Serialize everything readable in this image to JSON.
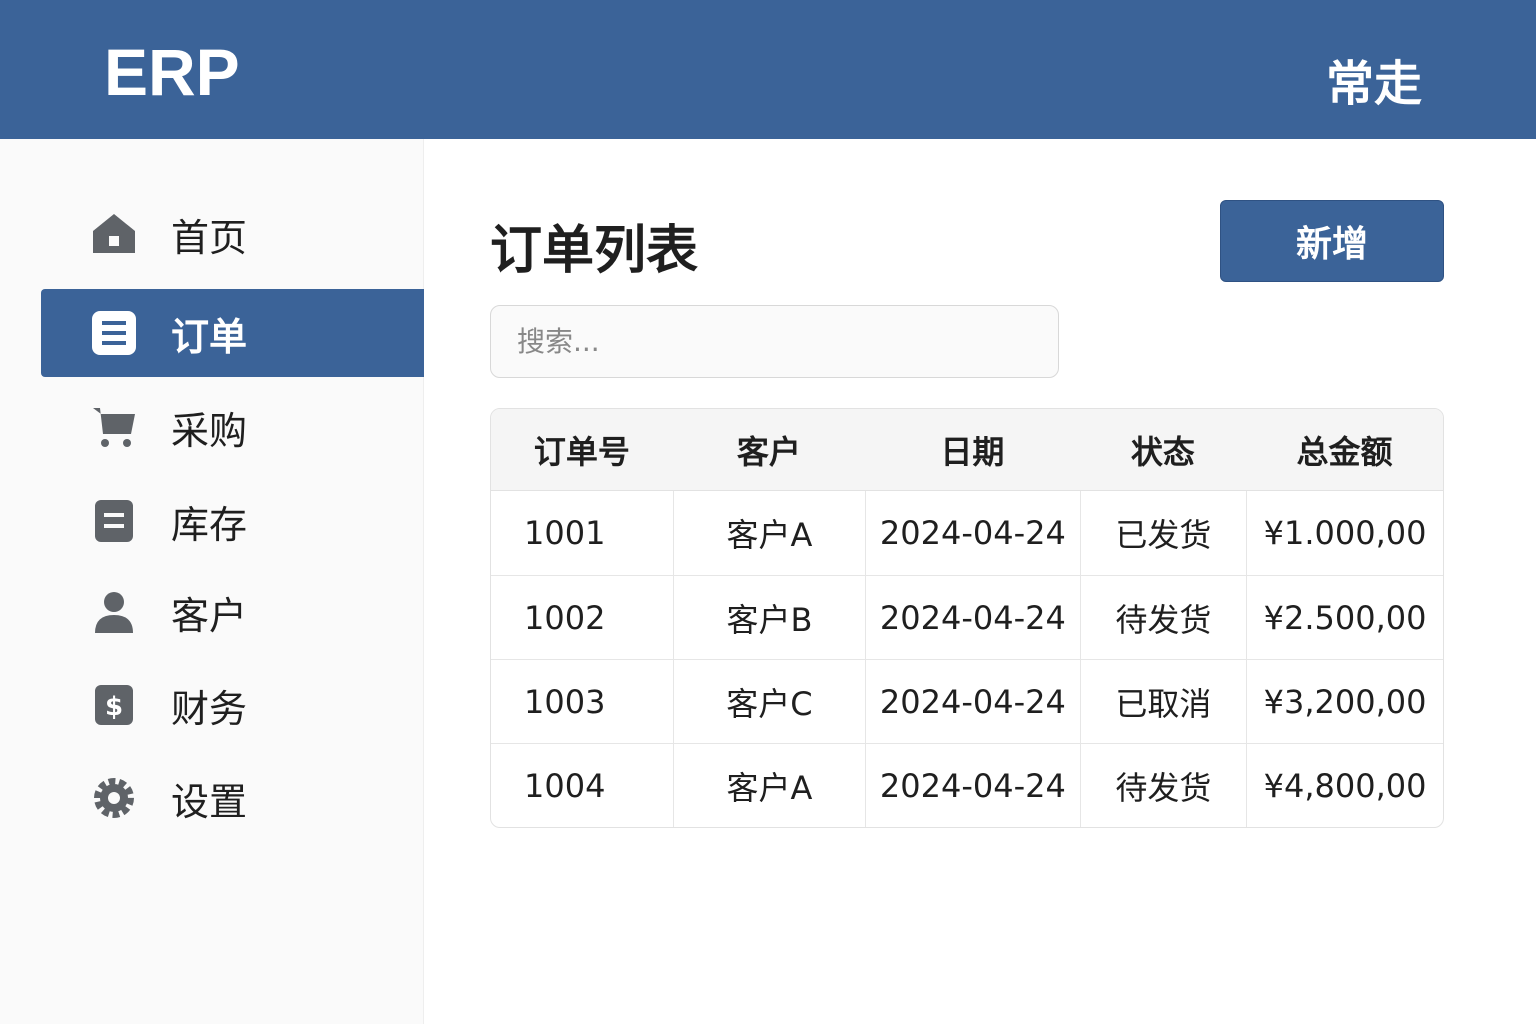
{
  "header": {
    "logo": "ERP",
    "user": "常走"
  },
  "sidebar": {
    "items": [
      {
        "label": "首页",
        "icon": "home-icon"
      },
      {
        "label": "订单",
        "icon": "document-icon",
        "active": true
      },
      {
        "label": "采购",
        "icon": "cart-icon"
      },
      {
        "label": "库存",
        "icon": "inventory-icon"
      },
      {
        "label": "客户",
        "icon": "user-icon"
      },
      {
        "label": "财务",
        "icon": "dollar-icon"
      },
      {
        "label": "设置",
        "icon": "gear-icon"
      }
    ]
  },
  "main": {
    "title": "订单列表",
    "add_label": "新增",
    "search_placeholder": "搜索...",
    "columns": [
      "订单号",
      "客户",
      "日期",
      "状态",
      "总金额"
    ],
    "rows": [
      [
        "1001",
        "客户A",
        "2024-04-24",
        "已发货",
        "¥1.000,00"
      ],
      [
        "1002",
        "客户B",
        "2024-04-24",
        "待发货",
        "¥2.500,00"
      ],
      [
        "1003",
        "客户C",
        "2024-04-24",
        "已取消",
        "¥3,200,00"
      ],
      [
        "1004",
        "客户A",
        "2024-04-24",
        "待发货",
        "¥4,800,00"
      ]
    ]
  },
  "colors": {
    "primary": "#3b6398",
    "icon": "#5f6368"
  }
}
